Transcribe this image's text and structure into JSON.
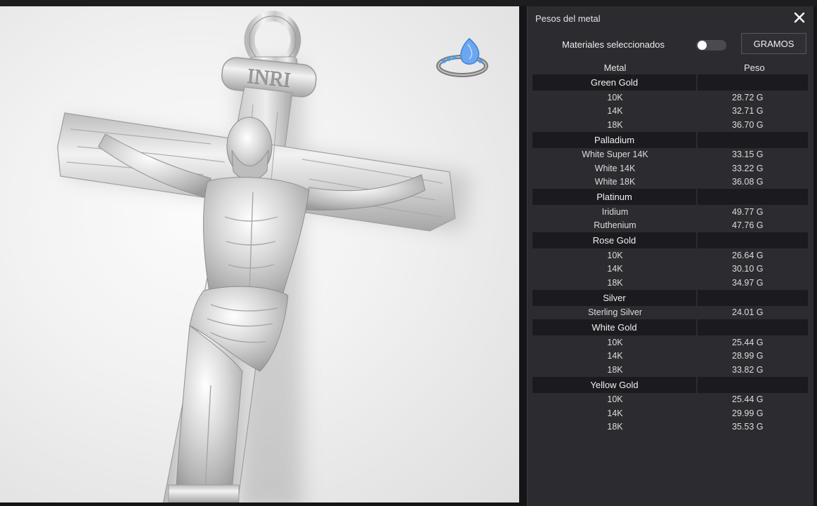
{
  "panel": {
    "title": "Pesos del metal",
    "materials_label": "Materiales seleccionados",
    "units_button": "GRAMOS",
    "toggle_on": false,
    "col_metal": "Metal",
    "col_weight": "Peso"
  },
  "groups": [
    {
      "name": "Green Gold",
      "items": [
        {
          "name": "10K",
          "weight": "28.72 G"
        },
        {
          "name": "14K",
          "weight": "32.71 G"
        },
        {
          "name": "18K",
          "weight": "36.70 G"
        }
      ]
    },
    {
      "name": "Palladium",
      "items": [
        {
          "name": "White Super 14K",
          "weight": "33.15 G"
        },
        {
          "name": "White 14K",
          "weight": "33.22 G"
        },
        {
          "name": "White 18K",
          "weight": "36.08 G"
        }
      ]
    },
    {
      "name": "Platinum",
      "items": [
        {
          "name": "Iridium",
          "weight": "49.77 G"
        },
        {
          "name": "Ruthenium",
          "weight": "47.76 G"
        }
      ]
    },
    {
      "name": "Rose Gold",
      "items": [
        {
          "name": "10K",
          "weight": "26.64 G"
        },
        {
          "name": "14K",
          "weight": "30.10 G"
        },
        {
          "name": "18K",
          "weight": "34.97 G"
        }
      ]
    },
    {
      "name": "Silver",
      "items": [
        {
          "name": "Sterling Silver",
          "weight": "24.01 G"
        }
      ]
    },
    {
      "name": "White Gold",
      "items": [
        {
          "name": "10K",
          "weight": "25.44 G"
        },
        {
          "name": "14K",
          "weight": "28.99 G"
        },
        {
          "name": "18K",
          "weight": "33.82 G"
        }
      ]
    },
    {
      "name": "Yellow Gold",
      "items": [
        {
          "name": "10K",
          "weight": "25.44 G"
        },
        {
          "name": "14K",
          "weight": "29.99 G"
        },
        {
          "name": "18K",
          "weight": "35.53 G"
        }
      ]
    }
  ],
  "model": {
    "inscription": "INRI"
  },
  "colors": {
    "panel_bg": "#2c2c30",
    "group_row_bg": "#1b1b1f",
    "ring_gem": "#6aa7f0",
    "metal": "#d9d9d9"
  }
}
